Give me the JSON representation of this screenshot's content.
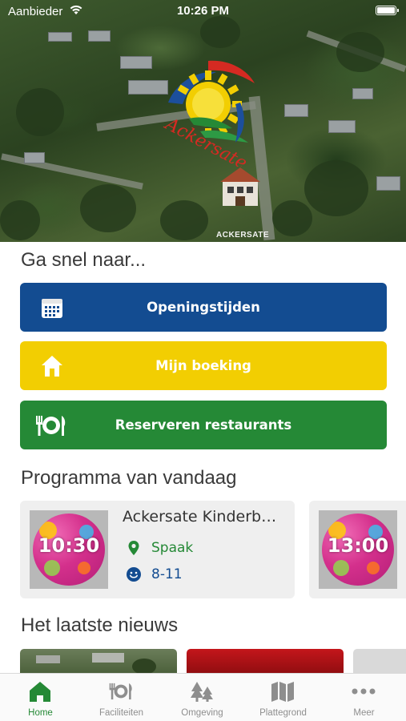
{
  "status_bar": {
    "carrier": "Aanbieder",
    "time": "10:26 PM"
  },
  "hero": {
    "logo_text": "Ackersate",
    "building_sign": "ACKERSATE"
  },
  "quick_links": {
    "title": "Ga snel naar...",
    "items": [
      {
        "label": "Openingstijden",
        "icon": "calendar-icon",
        "color": "#134c91"
      },
      {
        "label": "Mijn boeking",
        "icon": "home-icon",
        "color": "#f2ce02"
      },
      {
        "label": "Reserveren restaurants",
        "icon": "restaurant-icon",
        "color": "#258936"
      }
    ]
  },
  "program": {
    "title": "Programma van vandaag",
    "cards": [
      {
        "time": "10:30",
        "title": "Ackersate Kinderbi...",
        "location": "Spaak",
        "age": "8-11"
      },
      {
        "time": "13:00"
      }
    ]
  },
  "news": {
    "title": "Het laatste nieuws"
  },
  "tabbar": {
    "active": "Home",
    "tabs": [
      {
        "label": "Home",
        "icon": "home-icon"
      },
      {
        "label": "Faciliteiten",
        "icon": "restaurant-icon"
      },
      {
        "label": "Omgeving",
        "icon": "trees-icon"
      },
      {
        "label": "Plattegrond",
        "icon": "map-icon"
      },
      {
        "label": "Meer",
        "icon": "more-icon"
      }
    ]
  },
  "colors": {
    "brand_blue": "#134c91",
    "brand_yellow": "#f2ce02",
    "brand_green": "#258936",
    "card_bg": "#efefef",
    "thumb_pink": "#d4308c"
  }
}
